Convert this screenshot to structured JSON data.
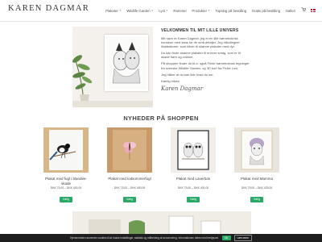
{
  "header": {
    "logo": "KAREN DAGMAR",
    "nav": [
      {
        "label": "Plakater",
        "caret": true
      },
      {
        "label": "Wildlife Garden",
        "caret": true
      },
      {
        "label": "Lyst",
        "caret": true
      },
      {
        "label": "Rammer",
        "caret": false
      },
      {
        "label": "Produkter",
        "caret": true
      },
      {
        "label": "Topsing på bestilling",
        "caret": false
      },
      {
        "label": "Gratis på bestilling",
        "caret": false
      },
      {
        "label": "Galleri",
        "caret": false
      }
    ],
    "cart_icon": "cart-icon",
    "language_flag": "danish-flag-icon"
  },
  "intro": {
    "title": "VELKOMMEN TIL MIT LILLE UNIVERS",
    "paragraphs": [
      "Mit navn er Karen Dagmar, jeg er en lille børneboknsk kunstner med sans for de små detaljer. Jeg håndtegner illustrationer, som bliver til skønne plakater med dyr.",
      "Du kan finde skønne plakater til enhver smag, som er til skade børn og voksne.",
      "På shoppen finder du bl.a. også Finde børneboknsk tegninger fra svenske Wildlife Garden, og 3D kort fra Fruke Lovi.",
      "Jeg håber at du kan lide hvad du ser.",
      "Kærlig hilsen"
    ],
    "signature": "Karen Dagmar"
  },
  "section_title": "NYHEDER PÅ SHOPPEN",
  "products": [
    {
      "name": "Plakat med fugl i blandee-skade",
      "price": "DKK 75,00 – DKK 400,00",
      "button": "Vælg"
    },
    {
      "name": "Plakat med lodsommerfugl",
      "price": "DKK 75,00 – DKK 400,00",
      "button": "Vælg"
    },
    {
      "name": "Plakat med Laverbdo",
      "price": "DKK 75,00 – DKK 400,00",
      "button": "Vælg"
    },
    {
      "name": "Plakat med Mamma",
      "price": "DKK 75,00 – DKK 425,00",
      "button": "Vælg"
    }
  ],
  "cookie": {
    "text": "Hjemmesiden anvender cookies til at huske indstillinger, statistik og målretning af annoncering. Informationen deles med tredjepart.",
    "accept": "OK",
    "more": "Læs mere"
  },
  "colors": {
    "accent": "#2aa866",
    "cookie_bg": "#1e1e1e"
  }
}
